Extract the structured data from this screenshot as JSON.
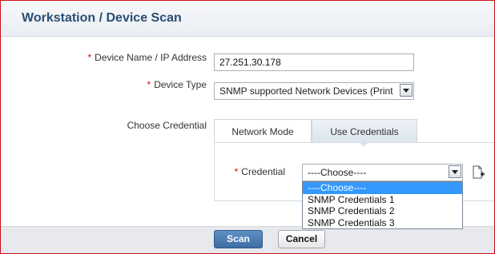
{
  "header": {
    "title": "Workstation / Device Scan"
  },
  "form": {
    "required_mark": "*",
    "device_name_label": "Device Name / IP Address",
    "device_name_value": "27.251.30.178",
    "device_type_label": "Device Type",
    "device_type_value": "SNMP supported Network Devices (Print",
    "choose_credential_label": "Choose Credential",
    "tabs": [
      {
        "label": "Network Mode",
        "active": false
      },
      {
        "label": "Use Credentials",
        "active": true
      }
    ],
    "credential_label": "Credential",
    "credential_value": "----Choose----",
    "credential_options": [
      "----Choose----",
      "SNMP Credentials 1",
      "SNMP Credentials 2",
      "SNMP Credentials 3"
    ],
    "credential_selected_index": 0
  },
  "footer": {
    "scan_label": "Scan",
    "cancel_label": "Cancel"
  },
  "icons": {
    "dropdown": "chevron-down-icon",
    "add_credential": "add-document-icon"
  },
  "colors": {
    "title": "#2b4e73",
    "required": "#dd0000",
    "selection": "#3399ff",
    "primary_button": "#3c6ea3",
    "window_border": "#c8121b"
  }
}
